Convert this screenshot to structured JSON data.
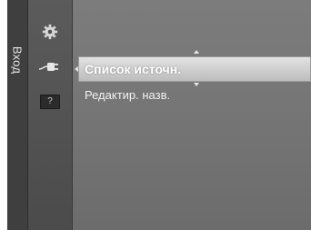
{
  "sidebar": {
    "title": "Вход",
    "icons": [
      {
        "name": "gear-icon"
      },
      {
        "name": "input-icon"
      },
      {
        "name": "help-icon",
        "label": "?"
      }
    ]
  },
  "menu": {
    "selected_item": "Список источн.",
    "items": [
      "Редактир. назв."
    ]
  },
  "colors": {
    "background": "#767676",
    "selected_bar": "#cfcfcf",
    "text": "#ffffff"
  }
}
